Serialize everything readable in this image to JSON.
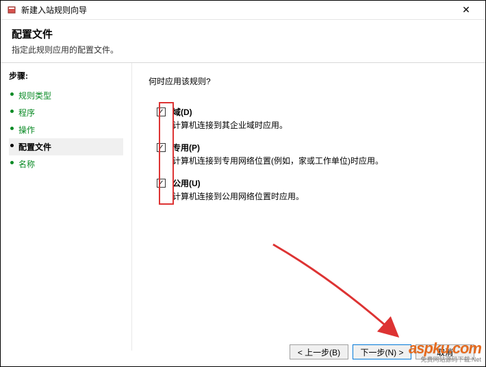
{
  "window": {
    "title": "新建入站规则向导",
    "close_glyph": "✕"
  },
  "header": {
    "title": "配置文件",
    "subtitle": "指定此规则应用的配置文件。"
  },
  "sidebar": {
    "heading": "步骤:",
    "items": [
      {
        "label": "规则类型",
        "active": false
      },
      {
        "label": "程序",
        "active": false
      },
      {
        "label": "操作",
        "active": false
      },
      {
        "label": "配置文件",
        "active": true
      },
      {
        "label": "名称",
        "active": false
      }
    ]
  },
  "main": {
    "prompt": "何时应用该规则?",
    "options": [
      {
        "label": "域(D)",
        "desc": "计算机连接到其企业域时应用。",
        "checked": true
      },
      {
        "label": "专用(P)",
        "desc": "计算机连接到专用网络位置(例如，家或工作单位)时应用。",
        "checked": true
      },
      {
        "label": "公用(U)",
        "desc": "计算机连接到公用网络位置时应用。",
        "checked": true
      }
    ]
  },
  "footer": {
    "back": "< 上一步(B)",
    "next": "下一步(N) >",
    "cancel": "取消"
  },
  "watermark": {
    "main": "aspku.com",
    "sub": "免费网站源码下载.Net"
  },
  "icons": {
    "check": "✓"
  }
}
